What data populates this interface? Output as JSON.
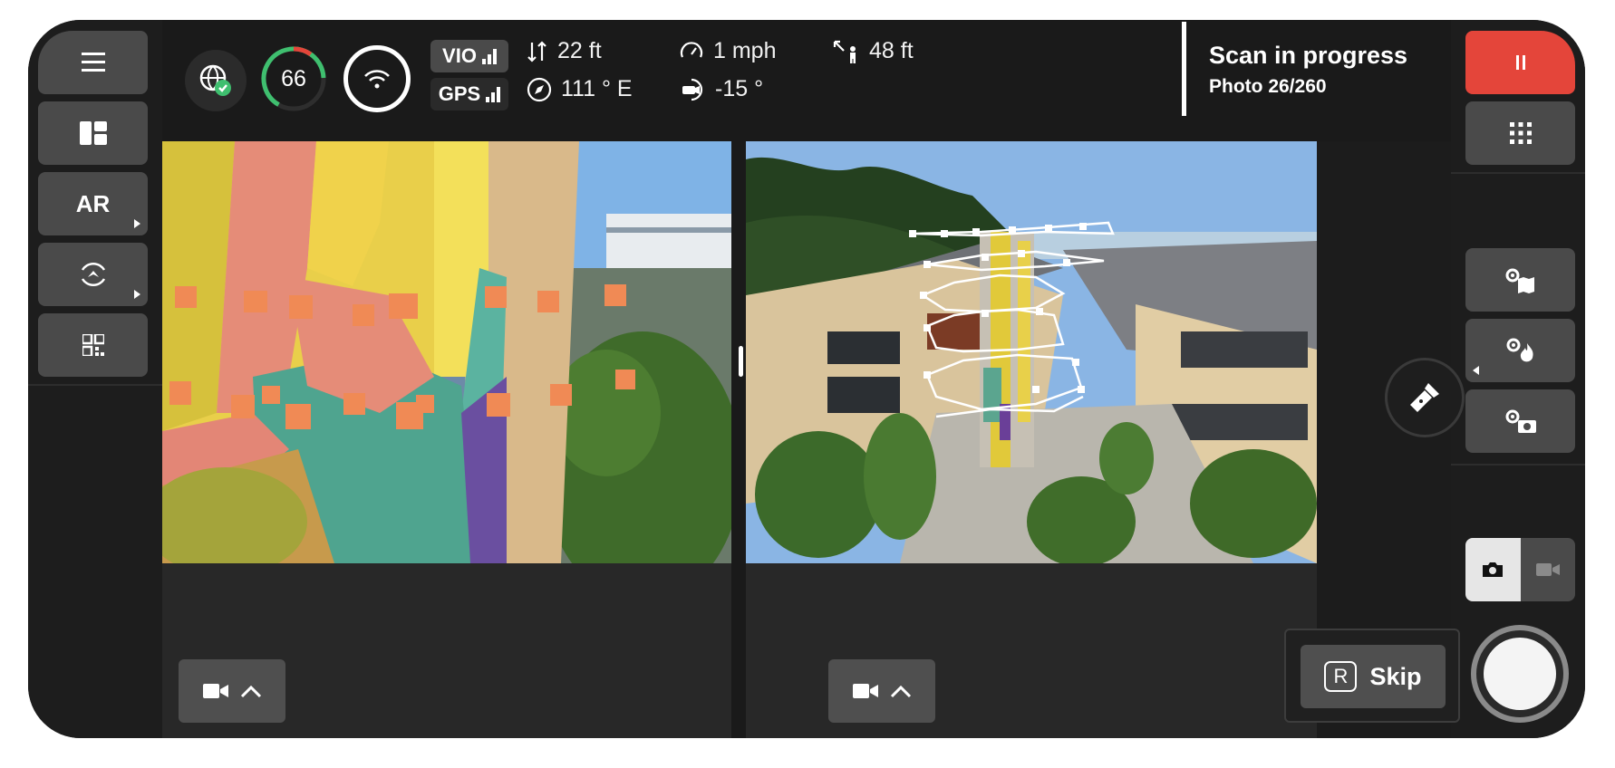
{
  "status": {
    "battery_percent": "66",
    "vio_label": "VIO",
    "gps_label": "GPS",
    "altitude": "22 ft",
    "heading": "111 ° E",
    "speed": "1 mph",
    "gimbal_pitch": "-15 °",
    "distance": "48 ft"
  },
  "scan": {
    "title": "Scan in progress",
    "photo_count": "Photo 26/260"
  },
  "left_rail": {
    "ar_label": "AR"
  },
  "skip": {
    "key": "R",
    "label": "Skip"
  },
  "colors": {
    "pause": "#e4453a",
    "battery_ring": "#3fbf6f",
    "battery_ring_low": "#e4453a"
  }
}
